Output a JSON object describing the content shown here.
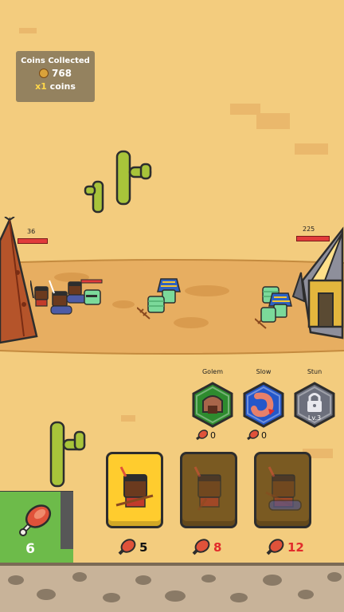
{
  "coins_panel": {
    "title": "Coins Collected",
    "amount": "768",
    "multiplier_x": "x1",
    "multiplier_unit": "coins"
  },
  "player_base": {
    "hp": "36",
    "hp_fraction": 0.9
  },
  "enemy_base": {
    "hp": "225",
    "hp_fraction": 1.0
  },
  "skills": [
    {
      "name": "Golem",
      "count": "0",
      "locked": false,
      "color": "#2e8b2e",
      "icon": "golem-icon"
    },
    {
      "name": "Slow",
      "count": "0",
      "locked": false,
      "color": "#2457c9",
      "icon": "slow-icon"
    },
    {
      "name": "Stun",
      "level": "Lv.3",
      "locked": true,
      "color": "#6c6f7c",
      "icon": "lock-icon"
    }
  ],
  "units": [
    {
      "name": "spear-warrior",
      "cost": "5",
      "affordable": true
    },
    {
      "name": "club-warrior",
      "cost": "8",
      "affordable": false
    },
    {
      "name": "wolf-rider",
      "cost": "12",
      "affordable": false
    }
  ],
  "meat": {
    "amount": "6",
    "fill_fraction": 0.2
  },
  "colors": {
    "sand": "#f3cc7e",
    "road": "#e7ae61",
    "cactus": "#a8c43a",
    "ok_cost": "#ffffff",
    "bad_cost": "#e22b2b",
    "card_active": "#ffcc2e",
    "card_inactive": "#7a5a22"
  }
}
